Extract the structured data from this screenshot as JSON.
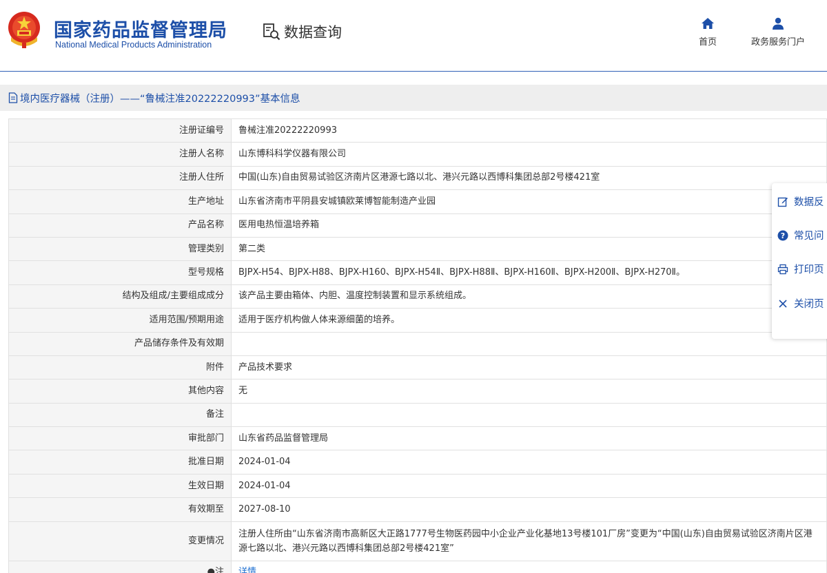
{
  "header": {
    "org_name_cn": "国家药品监督管理局",
    "org_name_en": "National Medical Products Administration",
    "query_label": "数据查询",
    "nav": {
      "home": "首页",
      "portal": "政务服务门户"
    }
  },
  "title_bar": {
    "text": "境内医疗器械（注册）——“鲁械注准20222220993”基本信息"
  },
  "rows": [
    {
      "label": "注册证编号",
      "value": "鲁械注准20222220993"
    },
    {
      "label": "注册人名称",
      "value": "山东博科科学仪器有限公司"
    },
    {
      "label": "注册人住所",
      "value": "中国(山东)自由贸易试验区济南片区港源七路以北、港兴元路以西博科集团总部2号楼421室"
    },
    {
      "label": "生产地址",
      "value": "山东省济南市平阴县安城镇欧莱博智能制造产业园"
    },
    {
      "label": "产品名称",
      "value": "医用电热恒温培养箱"
    },
    {
      "label": "管理类别",
      "value": "第二类"
    },
    {
      "label": "型号规格",
      "value": "BJPX-H54、BJPX-H88、BJPX-H160、BJPX-H54Ⅱ、BJPX-H88Ⅱ、BJPX-H160Ⅱ、BJPX-H200Ⅱ、BJPX-H270Ⅱ。"
    },
    {
      "label": "结构及组成/主要组成成分",
      "value": "该产品主要由箱体、内胆、温度控制装置和显示系统组成。"
    },
    {
      "label": "适用范围/预期用途",
      "value": "适用于医疗机构做人体来源细菌的培养。"
    },
    {
      "label": "产品储存条件及有效期",
      "value": ""
    },
    {
      "label": "附件",
      "value": "产品技术要求"
    },
    {
      "label": "其他内容",
      "value": "无"
    },
    {
      "label": "备注",
      "value": ""
    },
    {
      "label": "审批部门",
      "value": "山东省药品监督管理局"
    },
    {
      "label": "批准日期",
      "value": "2024-01-04"
    },
    {
      "label": "生效日期",
      "value": "2024-01-04"
    },
    {
      "label": "有效期至",
      "value": "2027-08-10"
    },
    {
      "label": "变更情况",
      "value": "注册人住所由“山东省济南市高新区大正路1777号生物医药园中小企业产业化基地13号楼101厂房”变更为“中国(山东)自由贸易试验区济南片区港源七路以北、港兴元路以西博科集团总部2号楼421室”"
    },
    {
      "label": "●注",
      "value": "详情"
    }
  ],
  "side_panel": {
    "feedback": "数据反",
    "faq": "常见问",
    "print": "打印页",
    "close": "关闭页"
  },
  "colors": {
    "brand_blue": "#1d4fa8",
    "link_blue": "#1d6fd1",
    "title_bar_bg": "#eeeeee",
    "label_bg": "#f5f5f5"
  },
  "icons": {
    "logo": "national-emblem-icon",
    "query": "search-document-icon",
    "home": "home-icon",
    "portal": "user-icon",
    "title": "document-icon",
    "feedback": "edit-icon",
    "faq": "question-icon",
    "print": "printer-icon",
    "close": "close-icon"
  }
}
